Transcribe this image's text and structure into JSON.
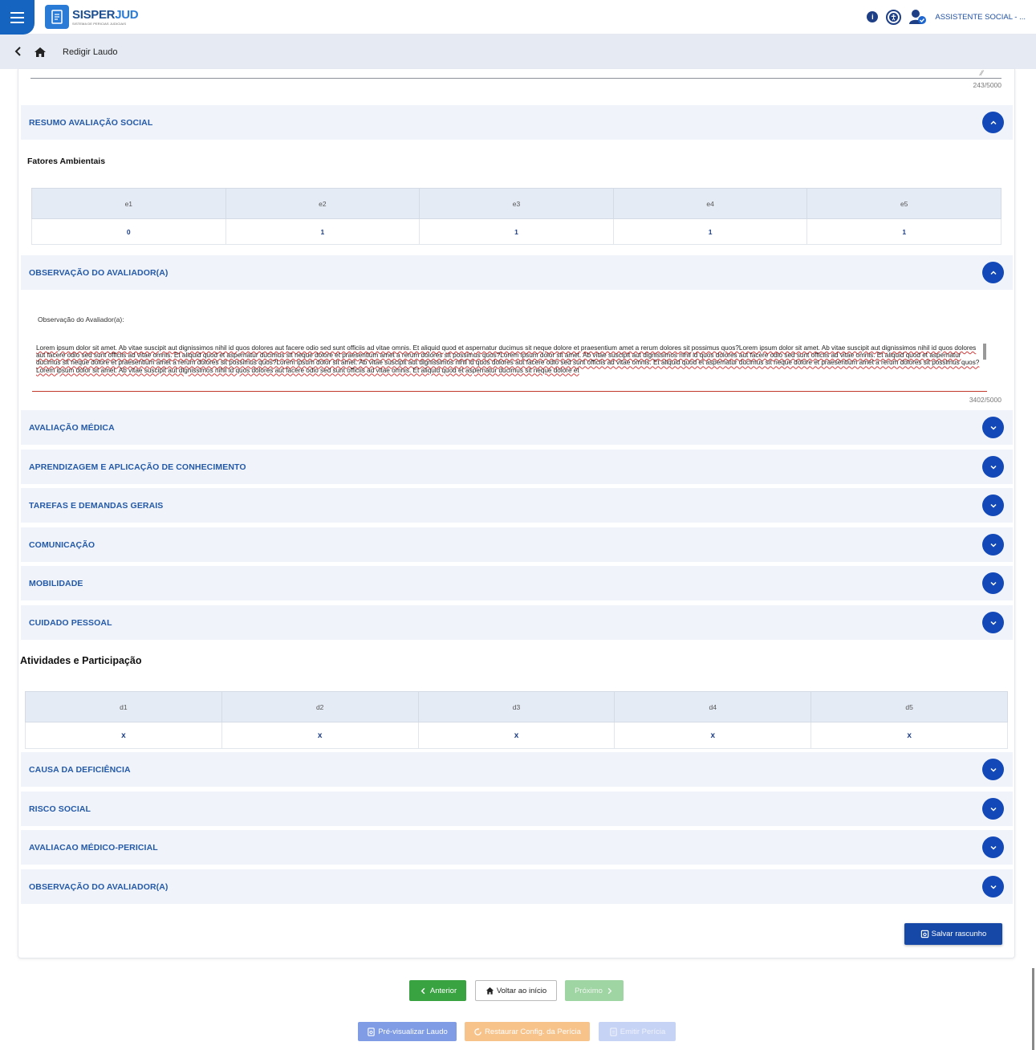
{
  "app": {
    "logo_title_a": "SISPER",
    "logo_title_b": "JUD",
    "logo_subtitle": "SISTEMA DE PERICIAS JUDICIAIS",
    "user_label": "ASSISTENTE SOCIAL - ..."
  },
  "breadcrumb": {
    "current": "Redigir Laudo"
  },
  "counters": {
    "top": "243/5000",
    "obs": "3402/5000"
  },
  "sections": {
    "resumo": "RESUMO AVALIAÇÃO SOCIAL",
    "observacao1": "OBSERVAÇÃO DO AVALIADOR(A)",
    "avaliacao_medica": "AVALIAÇÃO MÉDICA",
    "aprendizagem": "APRENDIZAGEM E APLICAÇÃO DE CONHECIMENTO",
    "tarefas": "TAREFAS E DEMANDAS GERAIS",
    "comunicacao": "COMUNICAÇÃO",
    "mobilidade": "MOBILIDADE",
    "cuidado": "CUIDADO PESSOAL",
    "causa": "CAUSA DA DEFICIÊNCIA",
    "risco": "RISCO SOCIAL",
    "avaliacao_pericial": "AVALIACAO MÉDICO-PERICIAL",
    "observacao2": "OBSERVAÇÃO DO AVALIADOR(A)"
  },
  "fatores": {
    "title": "Fatores Ambientais",
    "headers": [
      "e1",
      "e2",
      "e3",
      "e4",
      "e5"
    ],
    "values": [
      "0",
      "1",
      "1",
      "1",
      "1"
    ]
  },
  "atividades": {
    "title": "Atividades e Participação",
    "headers": [
      "d1",
      "d2",
      "d3",
      "d4",
      "d5"
    ],
    "values": [
      "x",
      "x",
      "x",
      "x",
      "x"
    ]
  },
  "observacao": {
    "label": "Observação do Avaliador(a):",
    "text": "Lorem ipsum dolor sit amet. Ab vitae suscipit aut dignissimos nihil id quos dolores aut facere odio sed sunt officiis ad vitae omnis. Et aliquid quod et aspernatur ducimus sit neque dolore et praesentium amet a rerum dolores sit possimus quos?Lorem ipsum dolor sit amet. Ab vitae suscipit aut dignissimos nihil id quos dolores aut facere odio sed sunt officiis ad vitae omnis. Et aliquid quod et aspernatur ducimus sit neque dolore et praesentium amet a rerum dolores sit possimus quos?Lorem ipsum dolor sit amet. Ab vitae suscipit aut dignissimos nihil id quos dolores aut facere odio sed sunt officiis ad vitae omnis. Et aliquid quod et aspernatur ducimus sit neque dolore et praesentium amet a rerum dolores sit possimus quos?Lorem ipsum dolor sit amet. Ab vitae suscipit aut dignissimos nihil id quos dolores aut facere odio sed sunt officiis ad vitae omnis. Et aliquid quod et aspernatur ducimus sit neque dolore et praesentium amet a rerum dolores sit possimus quos?Lorem ipsum dolor sit amet. Ab vitae suscipit aut dignissimos nihil id quos dolores aut facere odio sed sunt officiis ad vitae omnis. Et aliquid quod et aspernatur ducimus sit neque dolore et"
  },
  "buttons": {
    "save": "Salvar rascunho",
    "prev": "Anterior",
    "home": "Voltar ao início",
    "next": "Próximo",
    "preview": "Pré-visualizar Laudo",
    "restore": "Restaurar Config. da Perícia",
    "emit": "Emitir Perícia"
  },
  "colors": {
    "primary": "#1248b8",
    "section_title": "#2459a8",
    "section_bg": "#f0f4fa",
    "success": "#3aa341",
    "warning": "#f8c38b"
  },
  "icons": [
    "menu-icon",
    "document-icon",
    "info-icon",
    "accessibility-icon",
    "user-settings-icon",
    "back-icon",
    "home-icon",
    "chevron-up-icon",
    "chevron-down-icon",
    "save-icon",
    "chevron-left-icon",
    "chevron-right-icon",
    "preview-icon",
    "refresh-icon",
    "document-icon"
  ]
}
